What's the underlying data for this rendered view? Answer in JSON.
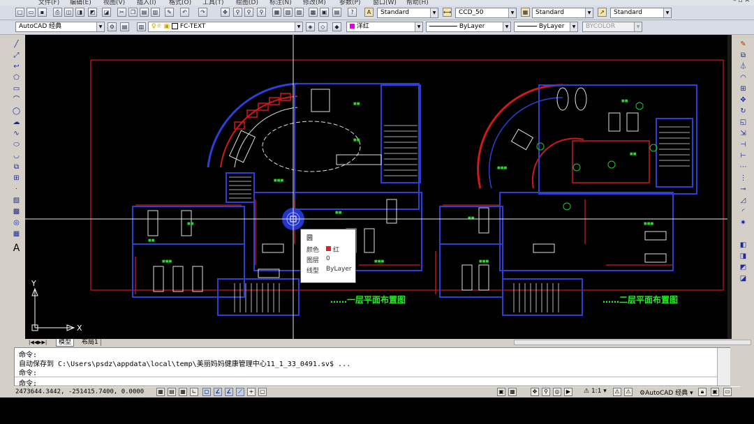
{
  "menu": {
    "items": [
      "文件(F)",
      "编辑(E)",
      "视图(V)",
      "插入(I)",
      "格式(O)",
      "工具(T)",
      "绘图(D)",
      "标注(N)",
      "修改(M)",
      "参数(P)",
      "窗口(W)",
      "帮助(H)"
    ]
  },
  "toolbar": {
    "text_style": "Standard",
    "dim_style": "CCD_50",
    "table_style": "Standard",
    "multileader_style": "Standard",
    "workspace": "AutoCAD 经典",
    "layer": "FC-TEXT",
    "color": "洋红",
    "linetype": "ByLayer",
    "lineweight": "ByLayer",
    "plotstyle": "BYCOLOR"
  },
  "drawing": {
    "label_floor1": "……一层平面布置图",
    "label_floor2": "……二层平面布置图",
    "ucs_x": "X",
    "ucs_y": "Y"
  },
  "tooltip": {
    "title": "圆",
    "rows": [
      {
        "key": "颜色",
        "value": "红"
      },
      {
        "key": "图层",
        "value": "0"
      },
      {
        "key": "线型",
        "value": "ByLayer"
      }
    ],
    "swatch_color": "#e02020"
  },
  "tabs": {
    "model": "模型",
    "layout1": "布局1"
  },
  "command": {
    "line1": "命令:",
    "line2": "自动保存到 C:\\Users\\psdz\\appdata\\local\\temp\\美丽妈妈健康管理中心11_1_33_0491.sv$ ...",
    "line3": "命令:",
    "prompt": "命令:"
  },
  "status": {
    "coordinates": "2473644.3442, -251415.7400, 0.0000",
    "scale": "1:1",
    "workspace": "AutoCAD 经典"
  },
  "colors": {
    "canvas": "#000000",
    "wall_blue": "#2d3fd6",
    "red_line": "#d21818",
    "green_text": "#22dd22",
    "label_text": "#22ee22"
  }
}
